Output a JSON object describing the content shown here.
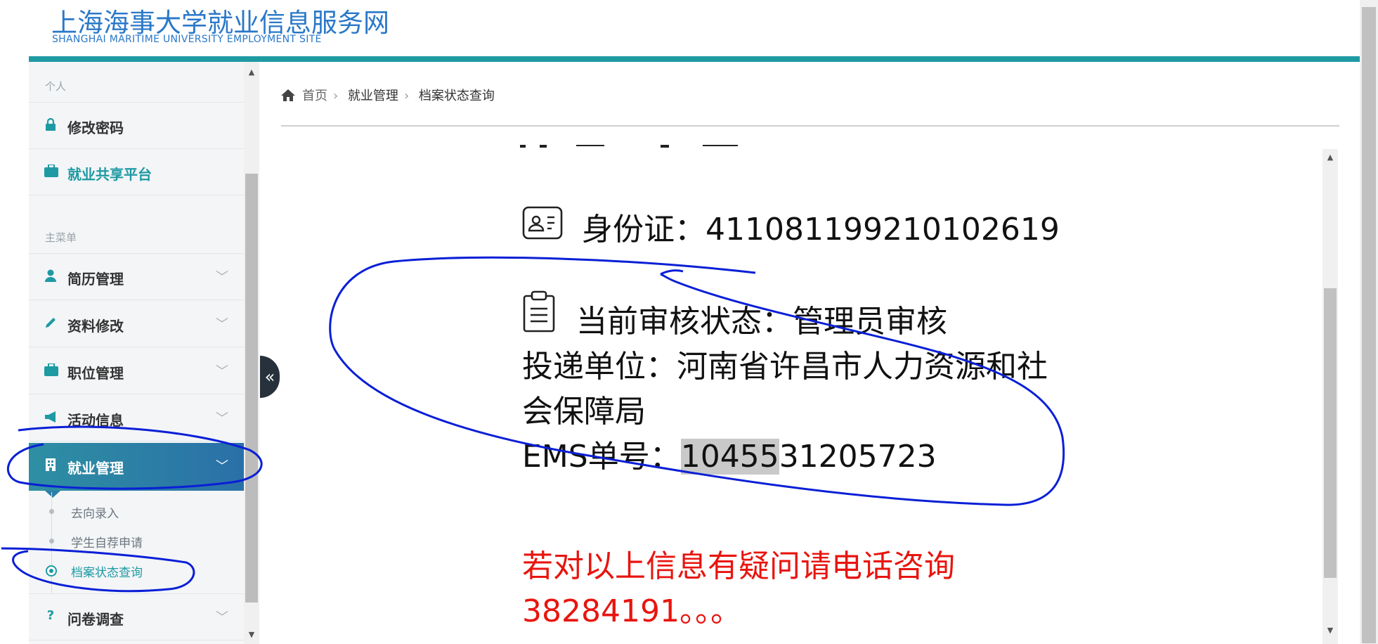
{
  "header": {
    "title": "上海海事大学就业信息服务网",
    "subtitle": "SHANGHAI MARITIME UNIVERSITY EMPLOYMENT SITE"
  },
  "sidebar": {
    "section_personal": "个人",
    "section_main": "主菜单",
    "items": [
      {
        "label": "修改密码",
        "icon": "lock-icon"
      },
      {
        "label": "就业共享平台",
        "icon": "briefcase-icon"
      },
      {
        "label": "简历管理",
        "icon": "user-icon"
      },
      {
        "label": "资料修改",
        "icon": "pencil-icon"
      },
      {
        "label": "职位管理",
        "icon": "briefcase-icon"
      },
      {
        "label": "活动信息",
        "icon": "megaphone-icon"
      },
      {
        "label": "就业管理",
        "icon": "building-icon"
      },
      {
        "label": "问卷调查",
        "icon": "question-icon"
      }
    ],
    "sub_items": [
      "去向录入",
      "学生自荐申请",
      "档案状态查询"
    ],
    "active_item": "就业管理",
    "active_sub_item": "档案状态查询"
  },
  "breadcrumb": {
    "home": "首页",
    "level1": "就业管理",
    "level2": "档案状态查询"
  },
  "record": {
    "id_text": "身份证：411081199210102619",
    "status_text": "当前审核状态：管理员审核",
    "unit_line1": "投递单位：河南省许昌市人力资源和社",
    "unit_line2": "会保障局",
    "ems_label": "EMS单号：",
    "ems_highlight": "10455",
    "ems_rest": "31205723",
    "notice_line1": "若对以上信息有疑问请电话咨询",
    "notice_line2": "38284191。。。"
  },
  "colors": {
    "brand": "#2a78c8",
    "accent_bar": "#1e9aa3",
    "active_menu": "#2e8fa3",
    "notice": "#e8150f",
    "annotation": "#0a1fd6"
  }
}
